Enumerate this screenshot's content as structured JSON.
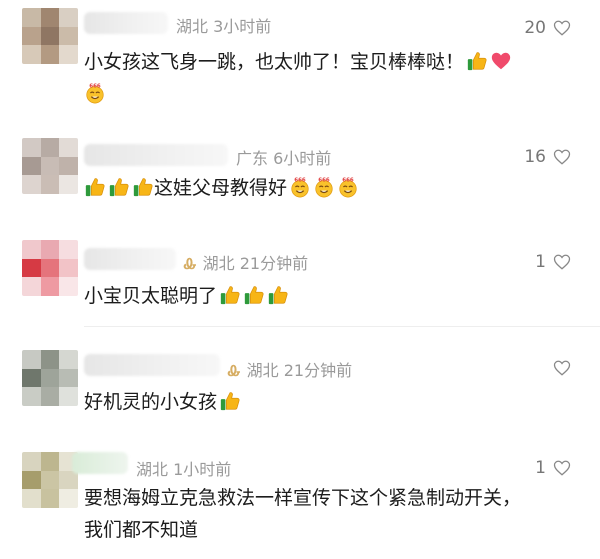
{
  "comments": [
    {
      "location": "湖北",
      "time": "3小时前",
      "likes": "20",
      "text": "小女孩这飞身一跳，也太帅了！宝贝棒棒哒！"
    },
    {
      "location": "广东",
      "time": "6小时前",
      "likes": "16",
      "text": "这娃父母教得好"
    },
    {
      "location": "湖北",
      "time": "21分钟前",
      "likes": "1",
      "text": "小宝贝太聪明了"
    },
    {
      "location": "湖北",
      "time": "21分钟前",
      "likes": "",
      "text": "好机灵的小女孩"
    },
    {
      "location": "湖北",
      "time": "1小时前",
      "likes": "1",
      "text_line1": "要想海姆立克急救法一样宣传下这个紧急制动开关，",
      "text_line2": "我们都不知道"
    }
  ],
  "icons": {
    "thumbs_up": "thumbs-up-icon",
    "heart": "heart-icon",
    "laugh_666": "666-laugh-icon",
    "vip": "vip-badge-icon"
  }
}
